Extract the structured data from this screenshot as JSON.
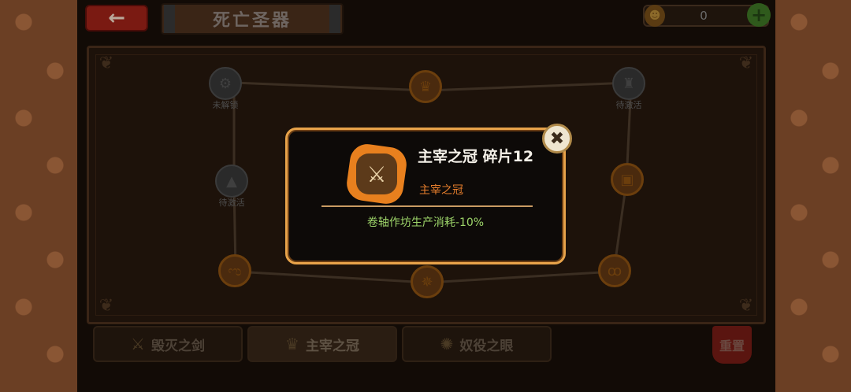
{
  "header": {
    "back_icon": "←",
    "title": "死亡圣器",
    "currency_icon": "demon-face",
    "currency_value": "0",
    "add_icon": "+"
  },
  "board": {
    "nodes": [
      {
        "id": "n1",
        "icon": "gear-lock",
        "label": "未解锁",
        "style": "grey"
      },
      {
        "id": "n2",
        "icon": "castle",
        "label": "待激活",
        "style": "grey"
      },
      {
        "id": "n3",
        "icon": "anvil",
        "label": "待激活",
        "style": "grey"
      },
      {
        "id": "n4",
        "icon": "crown-top",
        "label": "",
        "style": "orange"
      },
      {
        "id": "n5",
        "icon": "card",
        "label": "",
        "style": "orange"
      },
      {
        "id": "n6",
        "icon": "swirl",
        "label": "",
        "style": "orange"
      },
      {
        "id": "n7",
        "icon": "spike",
        "label": "",
        "style": "orange"
      },
      {
        "id": "n8",
        "icon": "curl",
        "label": "",
        "style": "orange"
      }
    ]
  },
  "tabs": [
    {
      "label": "毁灭之剑",
      "icon": "sword"
    },
    {
      "label": "主宰之冠",
      "icon": "crown"
    },
    {
      "label": "奴役之眼",
      "icon": "eye"
    }
  ],
  "reset_label": "重置",
  "popup": {
    "title": "主宰之冠 碎片12",
    "subtitle": "主宰之冠",
    "effect": "卷轴作坊生产消耗-10%",
    "close_icon": "✖",
    "item_icon": "shield-sword"
  },
  "colors": {
    "popup_border": "#e8a34a",
    "subtitle": "#e57d2c",
    "effect": "#9ed66a",
    "item_bg": "#e8801e"
  }
}
